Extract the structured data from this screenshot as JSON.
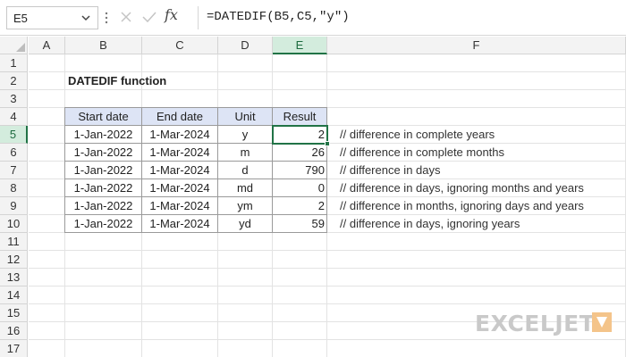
{
  "formula_bar": {
    "name_box": "E5",
    "fx_label": "fx",
    "formula": "=DATEDIF(B5,C5,\"y\")"
  },
  "columns": [
    "A",
    "B",
    "C",
    "D",
    "E",
    "F"
  ],
  "rows": [
    "1",
    "2",
    "3",
    "4",
    "5",
    "6",
    "7",
    "8",
    "9",
    "10",
    "11",
    "12",
    "13",
    "14",
    "15",
    "16",
    "17"
  ],
  "active": {
    "column": "E",
    "row": "5"
  },
  "sheet": {
    "title": "DATEDIF function",
    "table_headers": [
      "Start date",
      "End date",
      "Unit",
      "Result"
    ],
    "table_rows": [
      {
        "start": "1-Jan-2022",
        "end": "1-Mar-2024",
        "unit": "y",
        "result": "2",
        "comment": "// difference in complete years"
      },
      {
        "start": "1-Jan-2022",
        "end": "1-Mar-2024",
        "unit": "m",
        "result": "26",
        "comment": "// difference in complete months"
      },
      {
        "start": "1-Jan-2022",
        "end": "1-Mar-2024",
        "unit": "d",
        "result": "790",
        "comment": "// difference in days"
      },
      {
        "start": "1-Jan-2022",
        "end": "1-Mar-2024",
        "unit": "md",
        "result": "0",
        "comment": "// difference in days, ignoring months and years"
      },
      {
        "start": "1-Jan-2022",
        "end": "1-Mar-2024",
        "unit": "ym",
        "result": "2",
        "comment": "// difference in months, ignoring days and years"
      },
      {
        "start": "1-Jan-2022",
        "end": "1-Mar-2024",
        "unit": "yd",
        "result": "59",
        "comment": "// difference in days, ignoring years"
      }
    ]
  },
  "branding": {
    "logo_text": "EXCELJET"
  },
  "colors": {
    "accent_green": "#217346",
    "header_blue": "#dde4f5",
    "logo_gray": "#c9c9c9"
  }
}
